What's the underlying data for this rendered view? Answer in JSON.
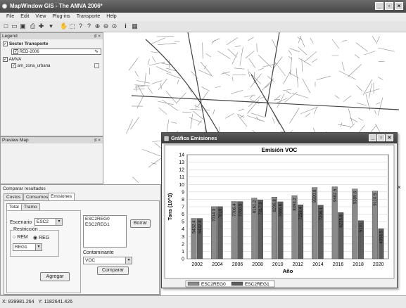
{
  "app": {
    "title": "MapWindow GIS - The AMVA 2006*"
  },
  "menu": [
    "File",
    "Edit",
    "View",
    "Plug-ins",
    "Transporte",
    "Help"
  ],
  "legend": {
    "title": "Legend",
    "groups": [
      {
        "name": "Sector Transporte",
        "layers": [
          "RED-2006"
        ]
      },
      {
        "name": "AMVA",
        "layers": [
          "am_zona_urbana"
        ]
      }
    ]
  },
  "preview": {
    "title": "Preview Map"
  },
  "compare": {
    "title": "Comparar resultados",
    "top_tabs": [
      "Costos",
      "Consumos",
      "Emisiones"
    ],
    "sub_tabs": [
      "Total",
      "Tramo"
    ],
    "scenario_label": "Escenario",
    "scenario_value": "ESC2",
    "restriction_label": "Restricción",
    "radio_rem": "REM",
    "radio_reg": "REG",
    "restriction_value": "REG1",
    "add_button": "Agregar",
    "list_items": [
      "ESC2REG0",
      "ESC2REG1"
    ],
    "delete_button": "Borrar",
    "pollutant_label": "Contaminante",
    "pollutant_value": "VOC",
    "compare_button": "Comparar"
  },
  "chart_window": {
    "title": "Gráfica Emisiones"
  },
  "chart_data": {
    "type": "bar",
    "title": "Emisión VOC",
    "xlabel": "Año",
    "ylabel": "Tons (10^3)",
    "ylim": [
      0,
      14
    ],
    "yticks": [
      0,
      1,
      2,
      3,
      4,
      5,
      6,
      7,
      8,
      9,
      10,
      11,
      12,
      13,
      14
    ],
    "categories": [
      "2002",
      "2004",
      "2006",
      "2008",
      "2010",
      "2012",
      "2014",
      "2016",
      "2018",
      "2020"
    ],
    "series": [
      {
        "name": "ESC2REG0",
        "values": [
          5.4324,
          7.0143,
          7.7064,
          8.1612,
          8.2968,
          8.4932,
          9.5908,
          9.6825,
          9.3896,
          9.1105
        ],
        "labels": [
          "5432.4",
          "7014.3",
          "7706.4",
          "8161.2",
          "8296.8",
          "8493.2",
          "9590.8",
          "9682.5",
          "9389.6",
          "9110.5"
        ]
      },
      {
        "name": "ESC2REG1",
        "values": [
          5.4324,
          7.019,
          7.7005,
          7.9178,
          7.6666,
          7.2589,
          7.2061,
          6.2258,
          5.131,
          4.0585
        ],
        "labels": [
          "5432.4",
          "7019",
          "7700.5",
          "7917.8",
          "7666.6",
          "7259.4",
          "7206.1",
          "6225.8",
          "5131",
          "4058.5"
        ]
      }
    ],
    "colors": {
      "ESC2REG0": "#8a8a8a",
      "ESC2REG1": "#5c5c5c"
    },
    "grid": true,
    "legend": "bottom"
  },
  "status": {
    "x": "X: 839981.264",
    "y": "Y: 1182641.426"
  }
}
